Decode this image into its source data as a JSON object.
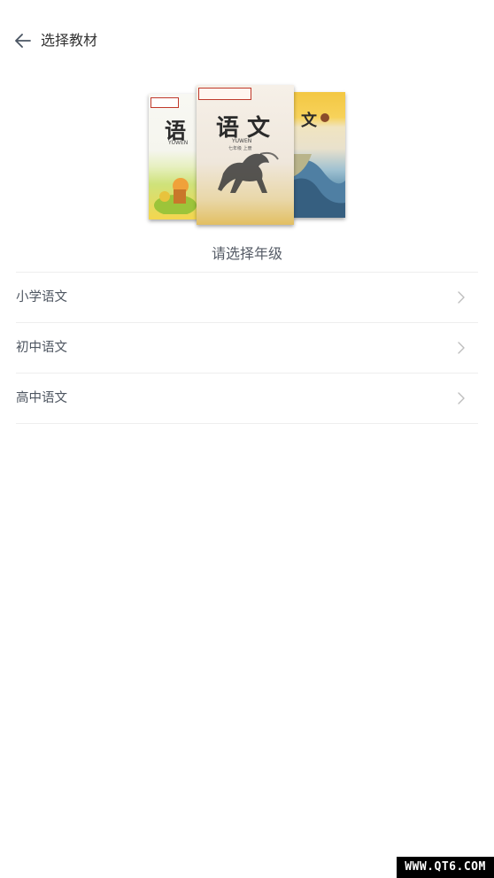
{
  "header": {
    "title": "选择教材",
    "back_icon": "arrow-left-icon"
  },
  "books": {
    "left": {
      "cover_title": "语",
      "subtitle": "YUWEN"
    },
    "center": {
      "cover_title": "语 文",
      "subtitle": "YUWEN",
      "grade": "七年级 上册"
    },
    "right": {
      "cover_title": "文"
    }
  },
  "subtitle": "请选择年级",
  "grades": [
    {
      "label": "小学语文",
      "icon": "chevron-right-icon"
    },
    {
      "label": "初中语文",
      "icon": "chevron-right-icon"
    },
    {
      "label": "高中语文",
      "icon": "chevron-right-icon"
    }
  ],
  "watermark": "WWW.QT6.COM",
  "colors": {
    "text_primary": "#333333",
    "text_secondary": "#4e5661",
    "divider": "#eeeeee",
    "chevron": "#bdbdbd"
  }
}
